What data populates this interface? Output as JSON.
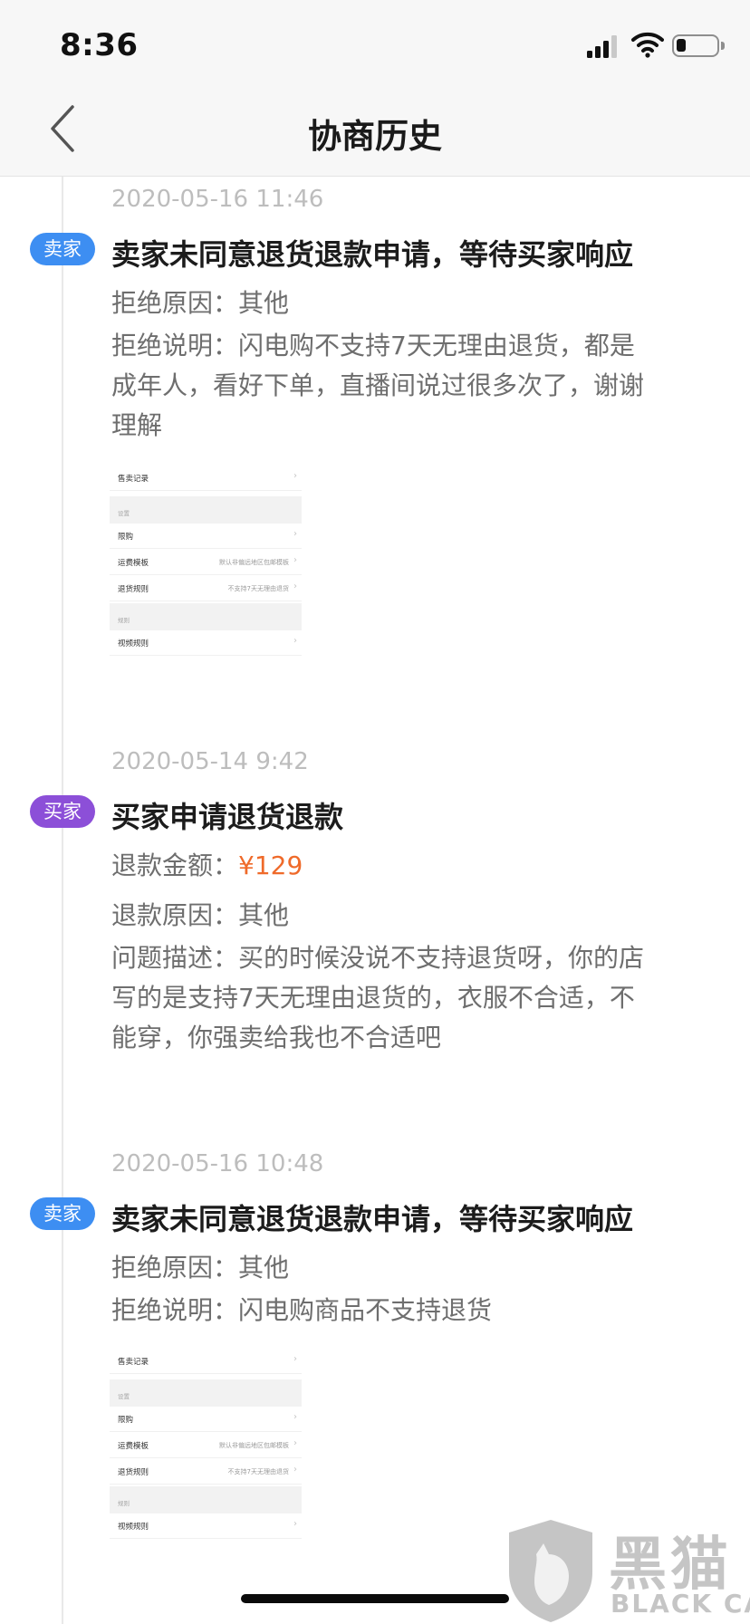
{
  "status_bar": {
    "time": "8:36"
  },
  "nav": {
    "title": "协商历史"
  },
  "entries": [
    {
      "timestamp": "2020-05-16 11:46",
      "role": "卖家",
      "title": "卖家未同意退货退款申请，等待买家响应",
      "reason": "拒绝原因：其他",
      "description_lines": [
        "拒绝说明：闪电购不支持7天无理由退货，都是",
        "成年人，看好下单，直播间说过很多次了，谢谢",
        "理解"
      ],
      "attachment": {
        "rows": [
          {
            "label": "售卖记录",
            "value": ""
          },
          {
            "section": "设置"
          },
          {
            "label": "限购",
            "value": ""
          },
          {
            "label": "运费模板",
            "value": "默认非偏远地区包邮模板"
          },
          {
            "label": "退货规则",
            "value": "不支持7天无理由退货"
          },
          {
            "section": "规则"
          },
          {
            "label": "视频规则",
            "value": ""
          }
        ]
      }
    },
    {
      "timestamp": "2020-05-14 9:42",
      "role": "买家",
      "title": "买家申请退货退款",
      "amount_label": "退款金额：",
      "amount_value": "¥129",
      "reason": "退款原因：其他",
      "description_lines": [
        "问题描述：买的时候没说不支持退货呀，你的店",
        "写的是支持7天无理由退货的，衣服不合适，不",
        "能穿，你强卖给我也不合适吧"
      ]
    },
    {
      "timestamp": "2020-05-16 10:48",
      "role": "卖家",
      "title": "卖家未同意退货退款申请，等待买家响应",
      "reason": "拒绝原因：其他",
      "description_lines": [
        "拒绝说明：闪电购商品不支持退货"
      ],
      "attachment": {
        "rows": [
          {
            "label": "售卖记录",
            "value": ""
          },
          {
            "section": "设置"
          },
          {
            "label": "限购",
            "value": ""
          },
          {
            "label": "运费模板",
            "value": "默认非偏远地区包邮模板"
          },
          {
            "label": "退货规则",
            "value": "不支持7天无理由退货"
          },
          {
            "section": "规则"
          },
          {
            "label": "视频规则",
            "value": ""
          }
        ]
      }
    }
  ],
  "watermark": {
    "chars": "黑猫",
    "latin": "BLACK CAT"
  },
  "colors": {
    "seller_badge": "#3d8ef2",
    "buyer_badge": "#8c4fd8",
    "amount": "#ef6a2a"
  }
}
